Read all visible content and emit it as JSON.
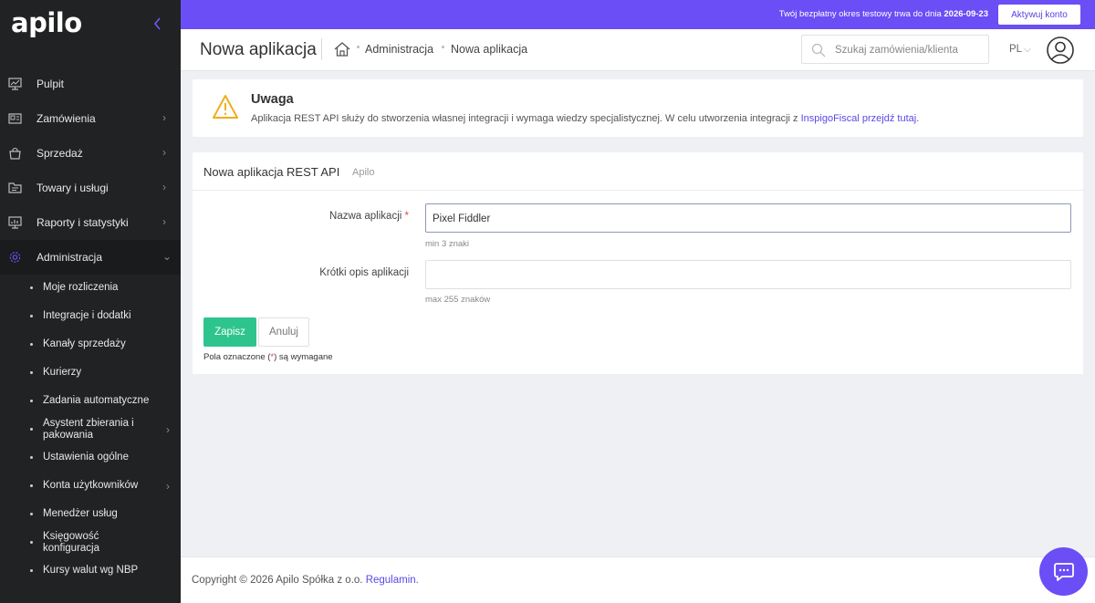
{
  "brand": {
    "logo_text": "apilo",
    "accent_color": "#6b4ef5",
    "success_color": "#2ec48e"
  },
  "trial": {
    "text_prefix": "Twój bezpłatny okres testowy trwa do dnia ",
    "end_date": "2026-09-23",
    "activate_label": "Aktywuj konto"
  },
  "header": {
    "title": "Nowa aplikacja",
    "breadcrumb": [
      "Administracja",
      "Nowa aplikacja"
    ],
    "search_placeholder": "Szukaj zamówienia/klienta",
    "language": "PL"
  },
  "sidebar": {
    "items": [
      {
        "label": "Pulpit",
        "icon": "monitor-icon",
        "has_children": false
      },
      {
        "label": "Zamówienia",
        "icon": "orders-icon",
        "has_children": true
      },
      {
        "label": "Sprzedaż",
        "icon": "shop-icon",
        "has_children": true
      },
      {
        "label": "Towary i usługi",
        "icon": "folder-icon",
        "has_children": true
      },
      {
        "label": "Raporty i statystyki",
        "icon": "report-icon",
        "has_children": true
      },
      {
        "label": "Administracja",
        "icon": "gear-icon",
        "has_children": true,
        "expanded": true
      }
    ],
    "sub_items": [
      {
        "label": "Moje rozliczenia"
      },
      {
        "label": "Integracje i dodatki"
      },
      {
        "label": "Kanały sprzedaży"
      },
      {
        "label": "Kurierzy"
      },
      {
        "label": "Zadania automatyczne"
      },
      {
        "label": "Asystent zbierania i pakowania",
        "has_children": true
      },
      {
        "label": "Ustawienia ogólne"
      },
      {
        "label": "Konta użytkowników",
        "has_children": true
      },
      {
        "label": "Menedżer usług"
      },
      {
        "label": "Księgowość konfiguracja"
      },
      {
        "label": "Kursy walut wg NBP"
      }
    ]
  },
  "alert": {
    "title": "Uwaga",
    "text": "Aplikacja REST API służy do stworzenia własnej integracji i wymaga wiedzy specjalistycznej. W celu utworzenia integracji z ",
    "link1": "InspigoFiscal",
    "link2": "przejdź tutaj",
    "suffix": "."
  },
  "form": {
    "title": "Nowa aplikacja REST API",
    "subtitle": "Apilo",
    "name_label": "Nazwa aplikacji",
    "required_mark": "*",
    "name_value": "Pixel Fiddler",
    "name_hint": "min 3 znaki",
    "desc_label": "Krótki opis aplikacji",
    "desc_value": "",
    "desc_hint": "max 255 znaków",
    "save_label": "Zapisz",
    "cancel_label": "Anuluj",
    "required_note_before": "Pola oznaczone (",
    "required_note_after": ") są wymagane"
  },
  "footer": {
    "copyright": "Copyright © 2026 Apilo Spółka z o.o.",
    "terms_link": "Regulamin."
  }
}
